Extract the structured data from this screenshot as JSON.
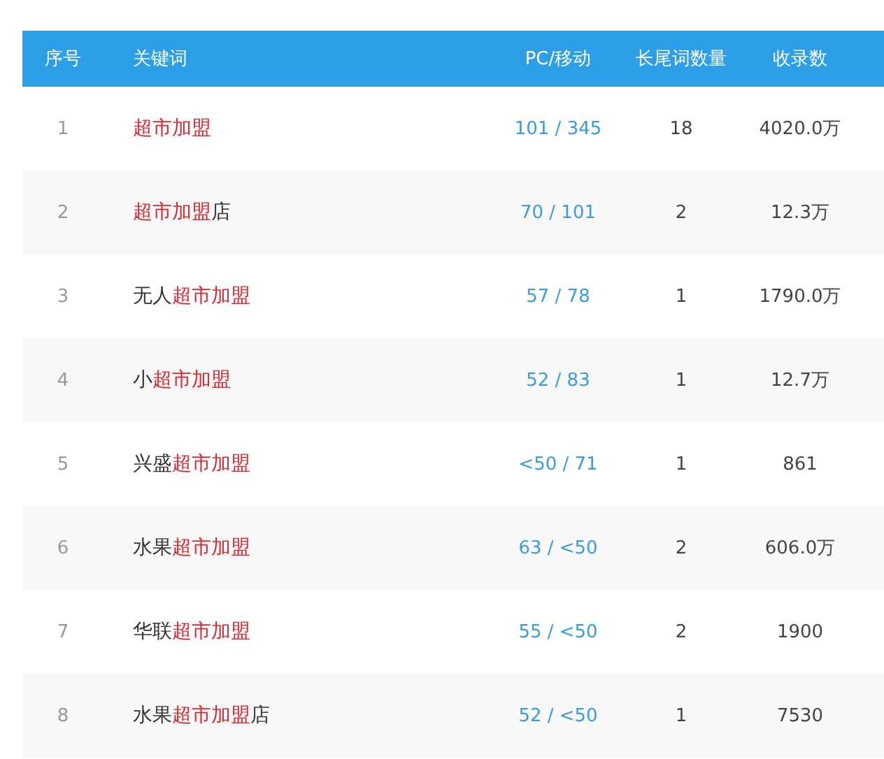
{
  "table": {
    "columns": [
      "序号",
      "关键词",
      "PC/移动",
      "长尾词数量",
      "收录数"
    ],
    "rows": [
      {
        "index": "1",
        "keyword": [
          {
            "text": "超市加盟",
            "highlight": true
          }
        ],
        "pc_mobile": "101 / 345",
        "long_tail": "18",
        "indexed": "4020.0万"
      },
      {
        "index": "2",
        "keyword": [
          {
            "text": "超市加盟",
            "highlight": true
          },
          {
            "text": "店",
            "highlight": false
          }
        ],
        "pc_mobile": "70 / 101",
        "long_tail": "2",
        "indexed": "12.3万"
      },
      {
        "index": "3",
        "keyword": [
          {
            "text": "无人",
            "highlight": false
          },
          {
            "text": "超市加盟",
            "highlight": true
          }
        ],
        "pc_mobile": "57 / 78",
        "long_tail": "1",
        "indexed": "1790.0万"
      },
      {
        "index": "4",
        "keyword": [
          {
            "text": "小",
            "highlight": false
          },
          {
            "text": "超市加盟",
            "highlight": true
          }
        ],
        "pc_mobile": "52 / 83",
        "long_tail": "1",
        "indexed": "12.7万"
      },
      {
        "index": "5",
        "keyword": [
          {
            "text": "兴盛",
            "highlight": false
          },
          {
            "text": "超市加盟",
            "highlight": true
          }
        ],
        "pc_mobile": "<50 / 71",
        "long_tail": "1",
        "indexed": "861"
      },
      {
        "index": "6",
        "keyword": [
          {
            "text": "水果",
            "highlight": false
          },
          {
            "text": "超市加盟",
            "highlight": true
          }
        ],
        "pc_mobile": "63 / <50",
        "long_tail": "2",
        "indexed": "606.0万"
      },
      {
        "index": "7",
        "keyword": [
          {
            "text": "华联",
            "highlight": false
          },
          {
            "text": "超市加盟",
            "highlight": true
          }
        ],
        "pc_mobile": "55 / <50",
        "long_tail": "2",
        "indexed": "1900"
      },
      {
        "index": "8",
        "keyword": [
          {
            "text": "水果",
            "highlight": false
          },
          {
            "text": "超市加盟",
            "highlight": true
          },
          {
            "text": "店",
            "highlight": false
          }
        ],
        "pc_mobile": "52 / <50",
        "long_tail": "1",
        "indexed": "7530"
      }
    ]
  }
}
